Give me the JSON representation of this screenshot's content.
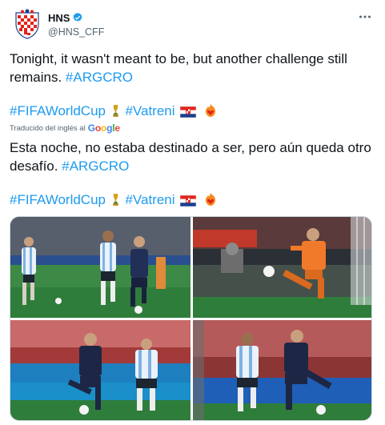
{
  "author": {
    "display_name": "HNS",
    "handle": "@HNS_CFF",
    "avatar_icon": "croatia-crest-icon",
    "verified_icon": "verified-badge-icon",
    "more_icon": "more-options-icon"
  },
  "tweet": {
    "text_original": "Tonight, it wasn't meant to be, but another challenge still remains.",
    "hashtag_1": "#ARGCRO",
    "hashtag_2": "#FIFAWorldCup",
    "hashtag_3": "#Vatreni",
    "translated_label": "Traducido del inglés al",
    "translator_brand": "Google",
    "text_translated": "Esta noche, no estaba destinado a ser, pero aún queda otro desafío.",
    "hashtag_4": "#ARGCRO",
    "hashtag_5": "#FIFAWorldCup",
    "hashtag_6": "#Vatreni"
  },
  "colors": {
    "link": "#1d9bf0",
    "text": "#0f1419",
    "secondary": "#536471",
    "pitch": "#2f7d3a"
  },
  "media": {
    "photos": [
      {
        "subject": "argentina-vs-croatia-players"
      },
      {
        "subject": "argentina-goalkeeper"
      },
      {
        "subject": "croatia-player-dribbling"
      },
      {
        "subject": "croatia-player-challenge"
      }
    ]
  }
}
